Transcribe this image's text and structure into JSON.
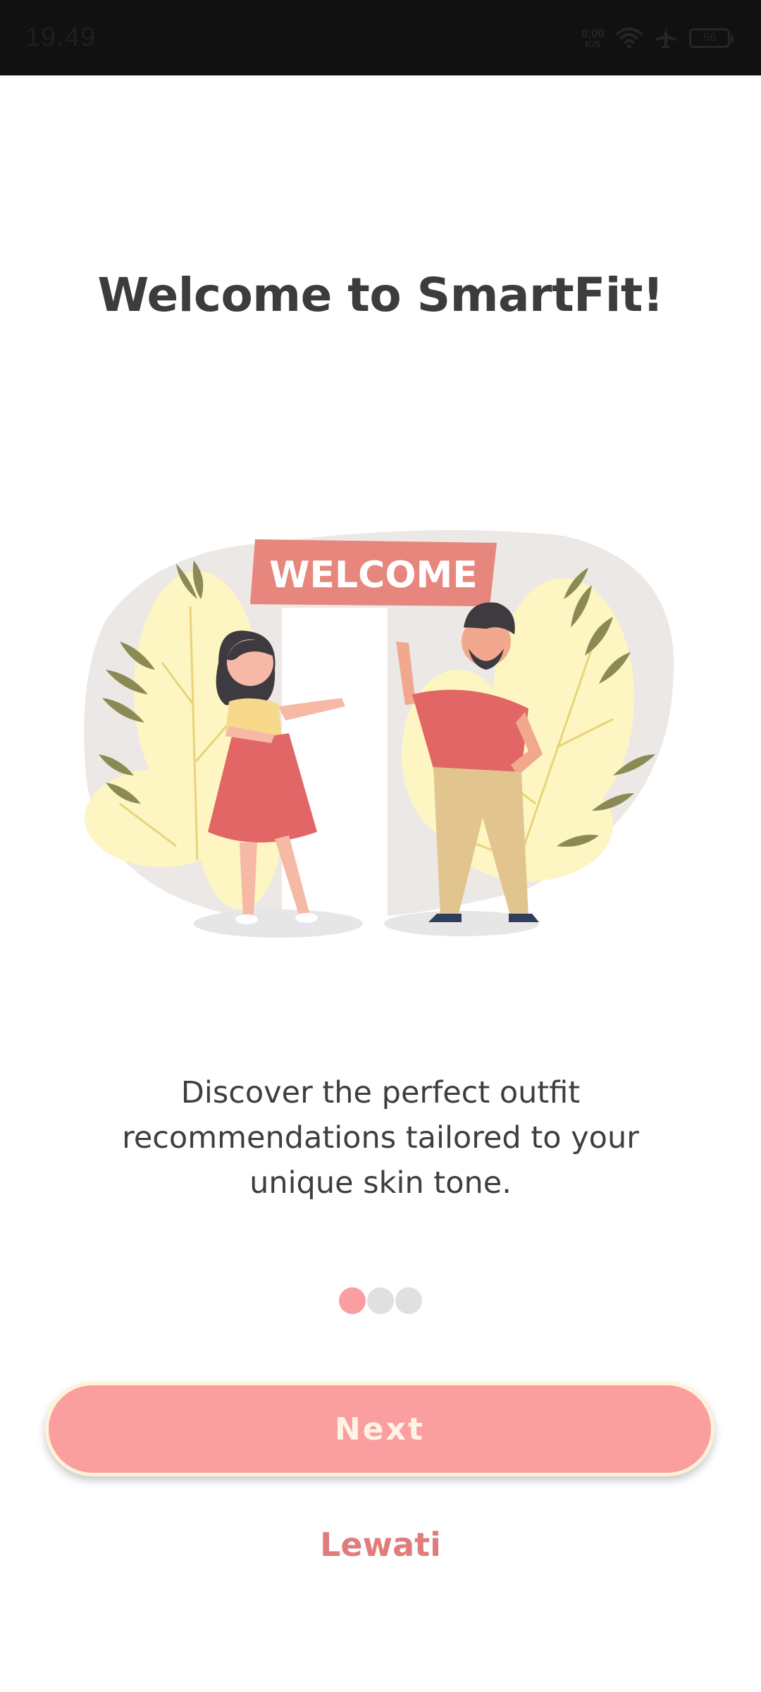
{
  "status_bar": {
    "time": "19.49",
    "net_speed_value": "0,00",
    "net_speed_unit": "K/S",
    "battery": "56",
    "icons": [
      "wifi-icon",
      "airplane-icon",
      "battery-icon"
    ]
  },
  "onboarding": {
    "title": "Welcome to SmartFit!",
    "illustration_sign": "WELCOME",
    "description": "Discover the perfect outfit recommendations tailored to your unique skin tone.",
    "page_indicator": {
      "total": 3,
      "active": 1
    },
    "next_label": "Next",
    "skip_label": "Lewati"
  },
  "colors": {
    "accent": "#fb9ea0",
    "accent_text": "#e07c7c",
    "title_text": "#3c3c3c",
    "dot_inactive": "#e0e0e0",
    "status_bar_bg": "#111111"
  }
}
